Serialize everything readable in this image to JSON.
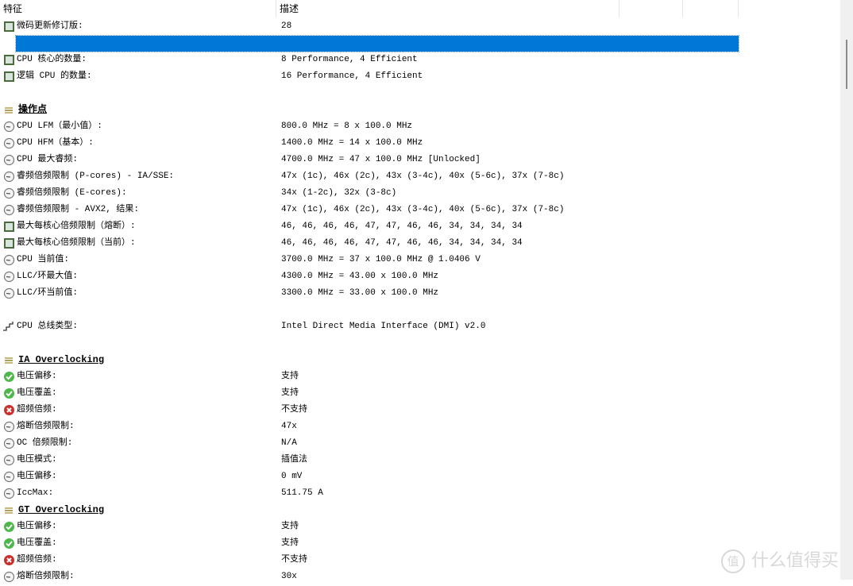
{
  "columns": [
    "特征",
    "描述",
    "",
    ""
  ],
  "rows": [
    {
      "icon": "chip",
      "label": "微码更新修订版:",
      "value": "28"
    },
    {
      "icon": "none",
      "label": "",
      "value": "",
      "selected": true
    },
    {
      "icon": "chip",
      "label": "CPU 核心的数量:",
      "value": "8 Performance, 4 Efficient"
    },
    {
      "icon": "chip",
      "label": "逻辑 CPU 的数量:",
      "value": "16 Performance, 4 Efficient"
    },
    {
      "icon": "none",
      "label": "",
      "value": ""
    },
    {
      "icon": "section",
      "label": "操作点",
      "value": "",
      "section": true
    },
    {
      "icon": "clock",
      "label": "CPU LFM（最小值）:",
      "value": "800.0 MHz = 8 x 100.0 MHz"
    },
    {
      "icon": "clock",
      "label": "CPU HFM（基本）:",
      "value": "1400.0 MHz = 14 x 100.0 MHz"
    },
    {
      "icon": "clock",
      "label": "CPU 最大睿频:",
      "value": "4700.0 MHz = 47 x 100.0 MHz [Unlocked]"
    },
    {
      "icon": "clock",
      "label": "睿频倍频限制 (P-cores) - IA/SSE:",
      "value": "47x (1c), 46x (2c), 43x (3-4c), 40x (5-6c), 37x (7-8c)"
    },
    {
      "icon": "clock",
      "label": "睿频倍频限制 (E-cores):",
      "value": "34x (1-2c), 32x (3-8c)"
    },
    {
      "icon": "clock",
      "label": "睿频倍频限制 - AVX2, 结果:",
      "value": "47x (1c), 46x (2c), 43x (3-4c), 40x (5-6c), 37x (7-8c)"
    },
    {
      "icon": "chip",
      "label": "最大每核心倍频限制（熔断）:",
      "value": "46, 46, 46, 46, 47, 47, 46, 46, 34, 34, 34, 34"
    },
    {
      "icon": "chip",
      "label": "最大每核心倍频限制（当前）:",
      "value": "46, 46, 46, 46, 47, 47, 46, 46, 34, 34, 34, 34"
    },
    {
      "icon": "clock",
      "label": "CPU 当前值:",
      "value": "3700.0 MHz = 37 x 100.0 MHz @ 1.0406 V"
    },
    {
      "icon": "clock",
      "label": "LLC/环最大值:",
      "value": "4300.0 MHz = 43.00 x 100.0 MHz"
    },
    {
      "icon": "clock",
      "label": "LLC/环当前值:",
      "value": "3300.0 MHz = 33.00 x 100.0 MHz"
    },
    {
      "icon": "none",
      "label": "",
      "value": ""
    },
    {
      "icon": "bus",
      "label": "CPU 总线类型:",
      "value": "Intel Direct Media Interface (DMI) v2.0"
    },
    {
      "icon": "none",
      "label": "",
      "value": ""
    },
    {
      "icon": "section",
      "label": "IA Overclocking",
      "value": "",
      "section": true
    },
    {
      "icon": "check",
      "label": "电压偏移:",
      "value": "支持"
    },
    {
      "icon": "check",
      "label": "电压覆盖:",
      "value": "支持"
    },
    {
      "icon": "cross",
      "label": "超频倍频:",
      "value": "不支持"
    },
    {
      "icon": "clock",
      "label": "熔断倍频限制:",
      "value": "47x"
    },
    {
      "icon": "clock",
      "label": "OC 倍频限制:",
      "value": "N/A"
    },
    {
      "icon": "clock",
      "label": "电压模式:",
      "value": "插值法"
    },
    {
      "icon": "clock",
      "label": "电压偏移:",
      "value": "0 mV"
    },
    {
      "icon": "clock",
      "label": "IccMax:",
      "value": "511.75 A"
    },
    {
      "icon": "section",
      "label": "GT Overclocking",
      "value": "",
      "section": true
    },
    {
      "icon": "check",
      "label": "电压偏移:",
      "value": "支持"
    },
    {
      "icon": "check",
      "label": "电压覆盖:",
      "value": "支持"
    },
    {
      "icon": "cross",
      "label": "超频倍频:",
      "value": "不支持"
    },
    {
      "icon": "clock",
      "label": "熔断倍频限制:",
      "value": "30x"
    }
  ],
  "watermark": "什么值得买",
  "colors": {
    "selection": "#0078d7",
    "check": "#3cb043",
    "cross": "#c62828"
  }
}
